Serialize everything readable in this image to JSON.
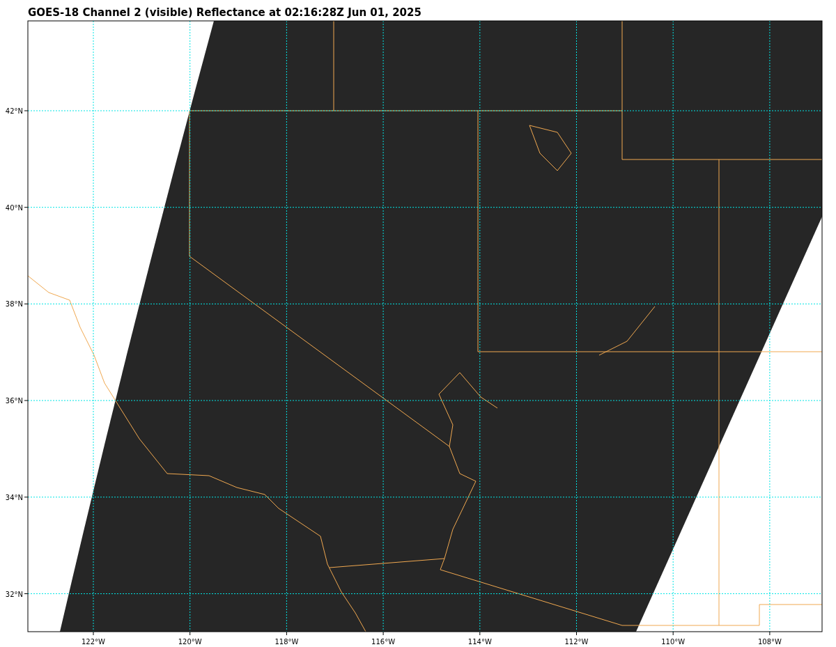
{
  "title": "GOES-18 Channel 2 (visible) Reflectance at 02:16:28Z Jun 01, 2025",
  "map": {
    "lat_labels": [
      "42°N",
      "40°N",
      "38°N",
      "36°N",
      "34°N",
      "32°N"
    ],
    "lon_labels": [
      "122°W",
      "120°W",
      "118°W",
      "116°W",
      "114°W",
      "112°W",
      "110°W",
      "108°W"
    ]
  }
}
